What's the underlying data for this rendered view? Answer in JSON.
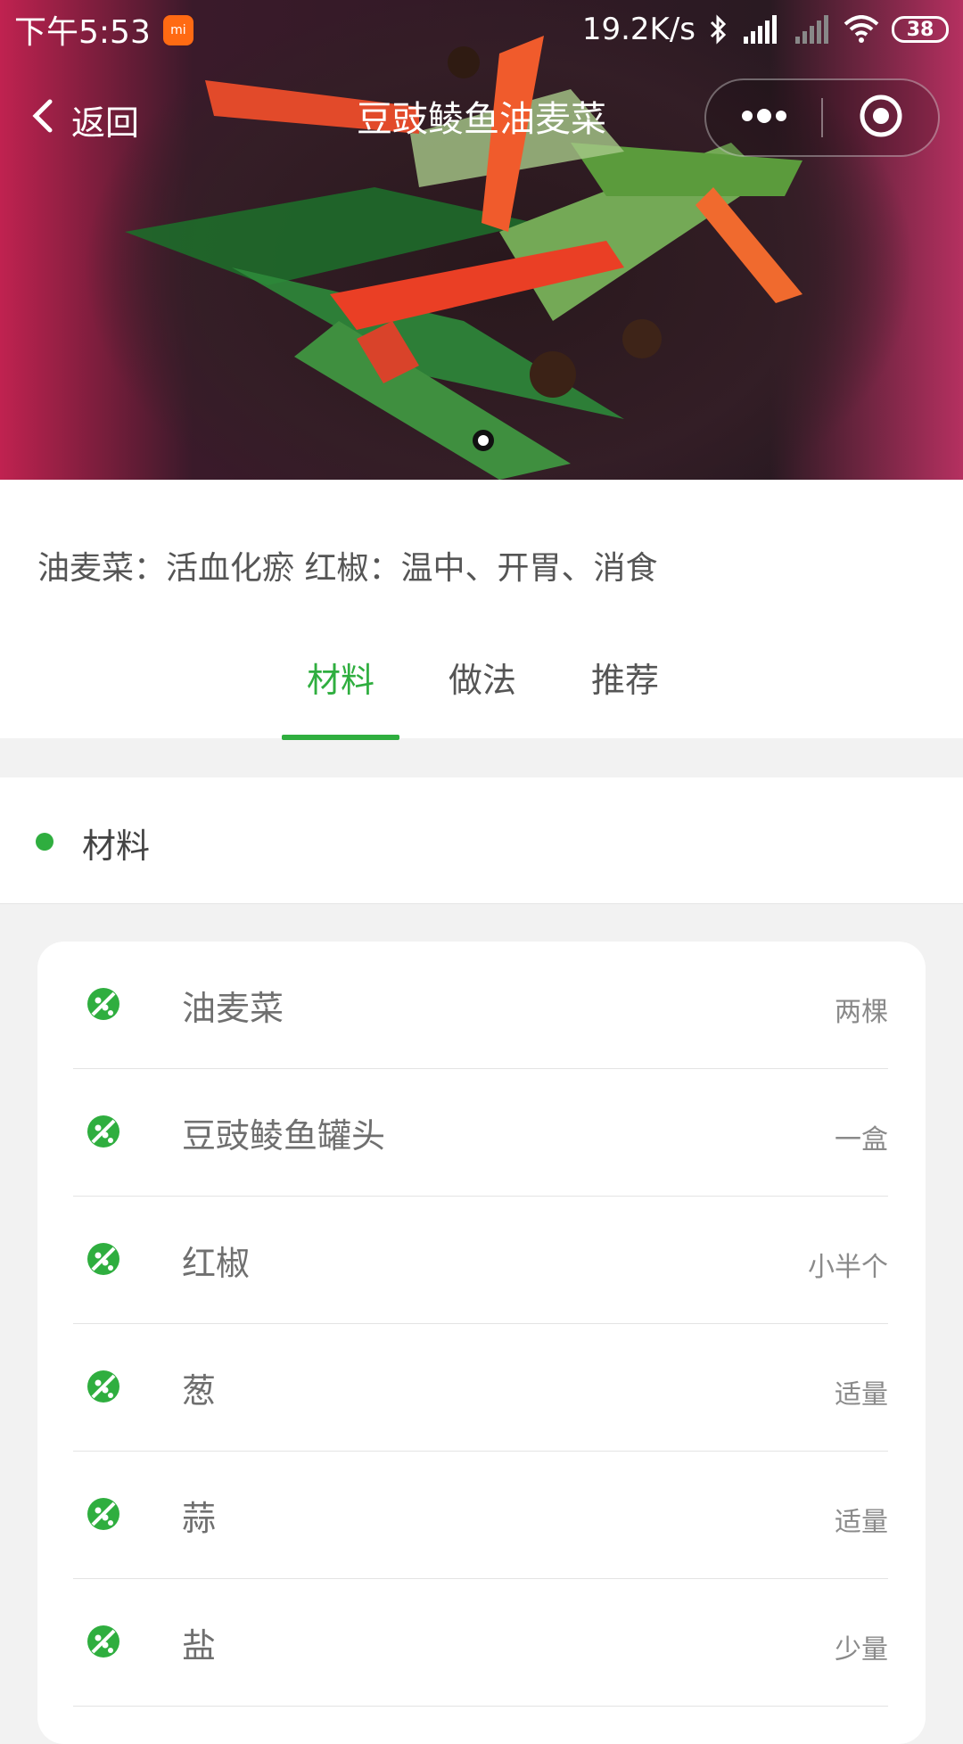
{
  "status_bar": {
    "time": "下午5:53",
    "speed": "19.2K/s",
    "battery": "38"
  },
  "nav": {
    "back_label": "返回",
    "title": "豆豉鲮鱼油麦菜"
  },
  "description": "油麦菜：活血化瘀 红椒：温中、开胃、消食",
  "tabs": [
    {
      "label": "材料"
    },
    {
      "label": "做法"
    },
    {
      "label": "推荐"
    }
  ],
  "section": {
    "title": "材料"
  },
  "ingredients": [
    {
      "name": "油麦菜",
      "qty": "两棵"
    },
    {
      "name": "豆豉鲮鱼罐头",
      "qty": "一盒"
    },
    {
      "name": "红椒",
      "qty": "小半个"
    },
    {
      "name": "葱",
      "qty": "适量"
    },
    {
      "name": "蒜",
      "qty": "适量"
    },
    {
      "name": "盐",
      "qty": "少量"
    }
  ],
  "colors": {
    "accent": "#2fae3f"
  }
}
